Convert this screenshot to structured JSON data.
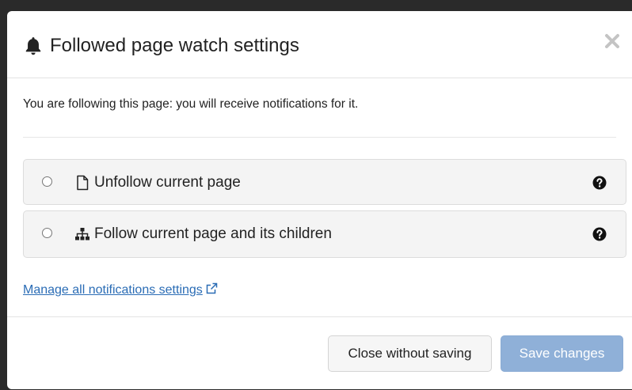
{
  "dialog": {
    "title": "Followed page watch settings",
    "intro": "You are following this page: you will receive notifications for it."
  },
  "options": [
    {
      "label": "Unfollow current page",
      "icon": "file-icon",
      "selected": false
    },
    {
      "label": "Follow current page and its children",
      "icon": "sitemap-icon",
      "selected": false
    }
  ],
  "links": {
    "manage": "Manage all notifications settings"
  },
  "footer": {
    "close_label": "Close without saving",
    "save_label": "Save changes"
  },
  "colors": {
    "link": "#2a6cb5",
    "save_button": "#8fb0d8",
    "option_background": "#f4f4f4"
  }
}
